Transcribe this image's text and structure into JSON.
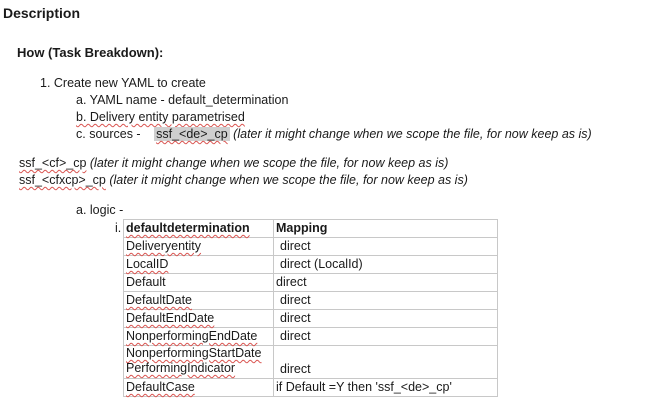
{
  "heading": "Description",
  "section_title": "How (Task Breakdown):",
  "steps": {
    "step1": "1. Create new YAML to create",
    "a": "a. YAML name - default_determination",
    "b": "b. Delivery entity parametrised",
    "c_prefix": "c. sources -",
    "c_code": "ssf_<de>_cp",
    "c_note": "(later it might change when we scope the file, for now keep as is)"
  },
  "source_lines": [
    {
      "code": "ssf_<cf>_cp",
      "note": "(later it might change when we scope the file, for now keep as is)"
    },
    {
      "code": "ssf_<cfxcp>_cp",
      "note": "(later it might change when we scope the file, for now keep as is)"
    }
  ],
  "logic_label": "a. logic -",
  "roman_marker": "i.",
  "mapping_table": {
    "headers": [
      "defaultdetermination",
      "Mapping"
    ],
    "rows": [
      [
        "Deliveryentity",
        "direct"
      ],
      [
        "LocalID",
        "direct (LocalId)"
      ],
      [
        "Default",
        "direct"
      ],
      [
        "DefaultDate",
        "direct"
      ],
      [
        "DefaultEndDate",
        "direct"
      ],
      [
        "NonperformingEndDate",
        "direct"
      ],
      [
        "NonperformingStartDate",
        ""
      ],
      [
        "PerformingIndicator",
        "direct"
      ],
      [
        "DefaultCase",
        "if Default =Y then 'ssf_<de>_cp'"
      ]
    ]
  }
}
